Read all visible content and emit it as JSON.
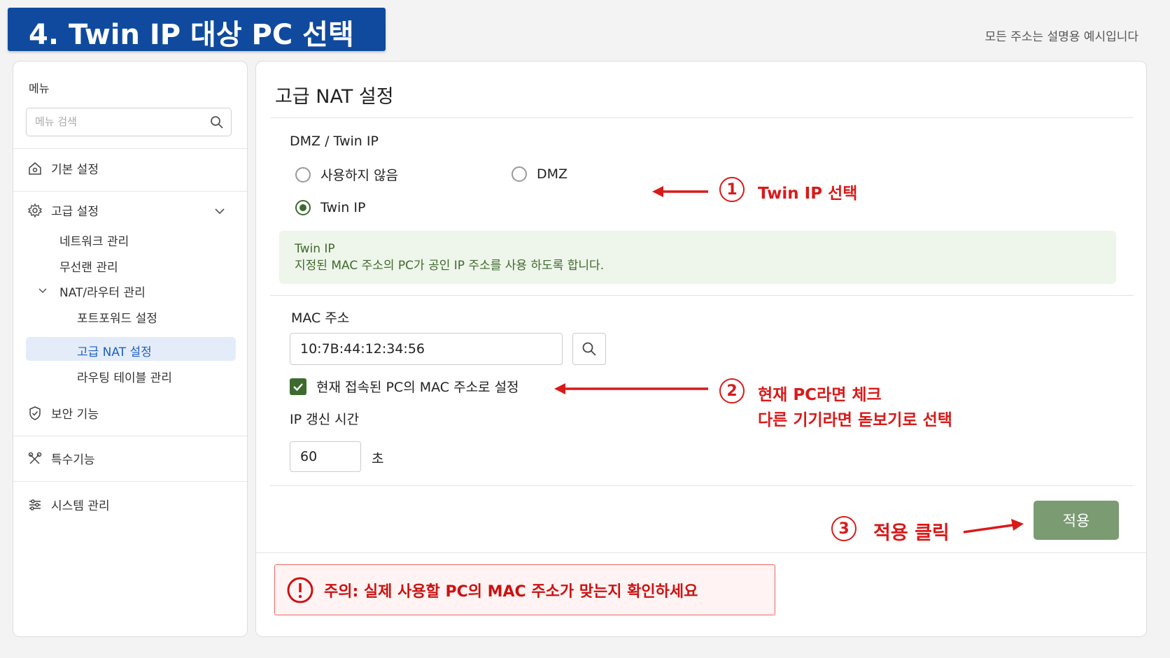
{
  "header": {
    "title": "4. Twin IP 대상 PC 선택",
    "notice": "모든 주소는 설명용 예시입니다"
  },
  "sidebar": {
    "menu_label": "메뉴",
    "search_placeholder": "메뉴 검색",
    "items": [
      {
        "label": "기본 설정",
        "icon": "home-gear-icon"
      },
      {
        "label": "고급 설정",
        "icon": "gear-icon"
      },
      {
        "label": "보안 기능",
        "icon": "shield-icon"
      },
      {
        "label": "특수기능",
        "icon": "tools-icon"
      },
      {
        "label": "시스템 관리",
        "icon": "sliders-icon"
      }
    ],
    "sub_items": [
      "네트워크 관리",
      "무선랜 관리",
      "NAT/라우터 관리"
    ],
    "nat_items": [
      "포트포워드 설정",
      "고급 NAT 설정",
      "라우팅 테이블 관리"
    ],
    "active_color": "#e4ecfa"
  },
  "main": {
    "title": "고급 NAT 설정",
    "section_title": "DMZ / Twin IP",
    "radio_options": [
      {
        "label": "사용하지 않음",
        "selected": false
      },
      {
        "label": "DMZ",
        "selected": false
      },
      {
        "label": "Twin IP",
        "selected": true
      }
    ],
    "info_title": "Twin IP",
    "info_text": "지정된 MAC 주소의 PC가 공인 IP 주소를 사용 하도록 합니다.",
    "mac_label": "MAC 주소",
    "mac_value": "10:7B:44:12:34:56",
    "checkbox_label": "현재 접속된 PC의 MAC 주소로 설정",
    "checkbox_checked": true,
    "ip_renew_label": "IP 갱신 시간",
    "ip_renew_value": "60",
    "ip_renew_unit": "초",
    "apply_button": "적용",
    "warning": "주의:  실제 사용할 PC의 MAC 주소가 맞는지 확인하세요"
  },
  "annotations": {
    "step1_num": "1",
    "step1_text": "Twin IP 선택",
    "step2_num": "2",
    "step2_line1": "현재 PC라면 체크",
    "step2_line2": "다른 기기라면 돋보기로 선택",
    "step3_num": "3",
    "step3_text": "적용 클릭",
    "color": "#d91a1a"
  }
}
